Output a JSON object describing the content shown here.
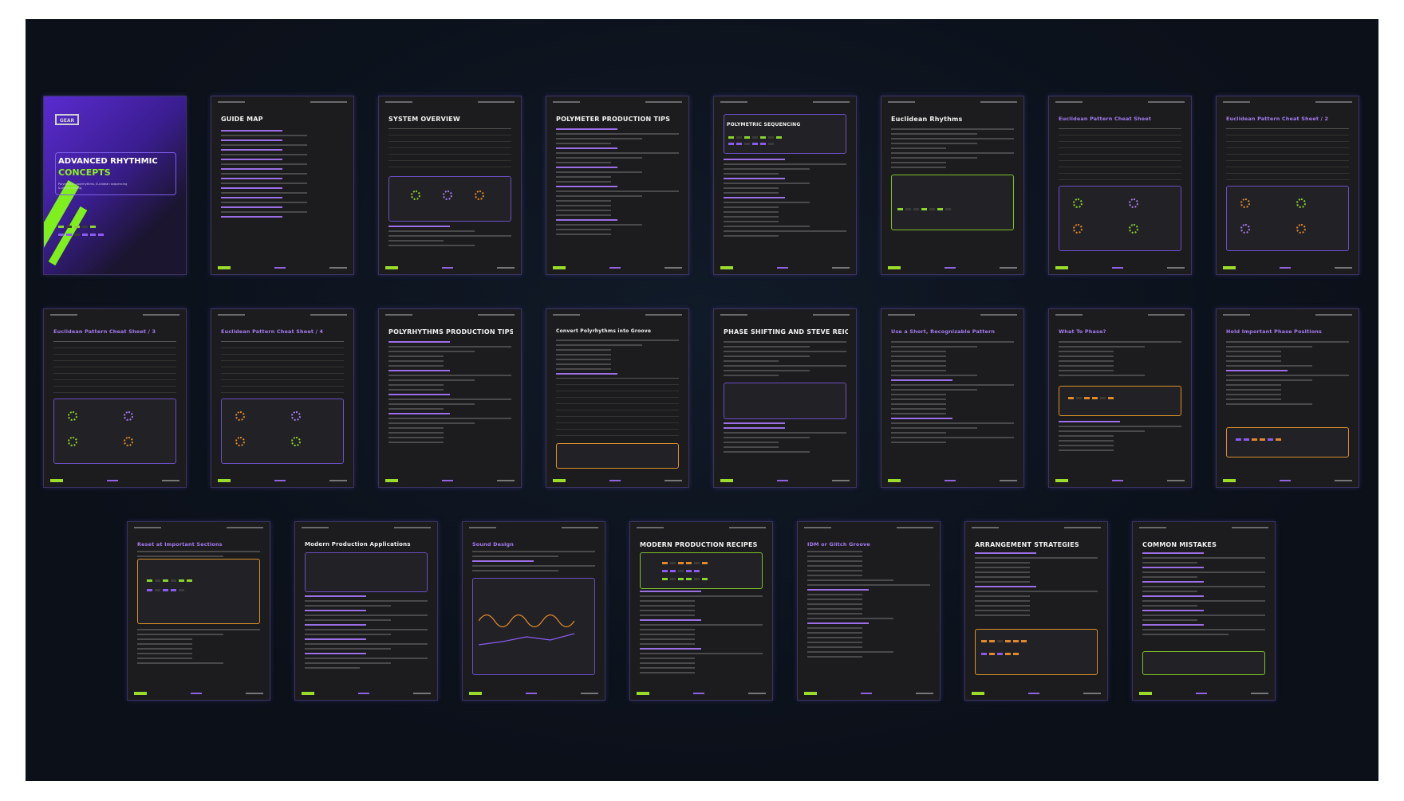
{
  "board": {
    "cover": {
      "logo": "GEAR",
      "title_line1": "ADVANCED RHYTHMIC",
      "title_line2": "CONCEPTS",
      "subtitle": "Polymeters, polyrhythms, Euclidean sequencing & phase shifting."
    },
    "pages": [
      {
        "title": "GUIDE MAP",
        "style": "white"
      },
      {
        "title": "SYSTEM OVERVIEW",
        "style": "white"
      },
      {
        "title": "POLYMETER PRODUCTION TIPS",
        "style": "white"
      },
      {
        "title": "POLYMETRIC SEQUENCING",
        "style": "white"
      },
      {
        "title": "Euclidean Rhythms",
        "style": "white"
      },
      {
        "title": "Euclidean Pattern Cheat Sheet",
        "style": "purple"
      },
      {
        "title": "Euclidean Pattern Cheat Sheet / 2",
        "style": "purple"
      },
      {
        "title": "Euclidean Pattern Cheat Sheet / 3",
        "style": "purple"
      },
      {
        "title": "Euclidean Pattern Cheat Sheet / 4",
        "style": "purple"
      },
      {
        "title": "POLYRHYTHMS PRODUCTION TIPS",
        "style": "white"
      },
      {
        "title": "Convert Polyrhythms into Groove",
        "style": "white"
      },
      {
        "title": "PHASE SHIFTING AND STEVE REICH",
        "style": "white"
      },
      {
        "title": "Use a Short, Recognizable Pattern",
        "style": "purple"
      },
      {
        "title": "What To Phase?",
        "style": "purple"
      },
      {
        "title": "Hold Important Phase Positions",
        "style": "purple"
      },
      {
        "title": "Reset at Important Sections",
        "style": "purple"
      },
      {
        "title": "Modern Production Applications",
        "style": "white"
      },
      {
        "title": "Sound Design",
        "style": "purple"
      },
      {
        "title": "MODERN PRODUCTION RECIPES",
        "style": "white"
      },
      {
        "title": "IDM or Glitch Groove",
        "style": "purple"
      },
      {
        "title": "ARRANGEMENT STRATEGIES",
        "style": "white"
      },
      {
        "title": "COMMON MISTAKES",
        "style": "white"
      }
    ]
  },
  "colors": {
    "background": "#0c111b",
    "page": "#1c1c1e",
    "accent_green": "#8bd42a",
    "accent_purple": "#8b5cf0",
    "accent_orange": "#e08a2a"
  }
}
